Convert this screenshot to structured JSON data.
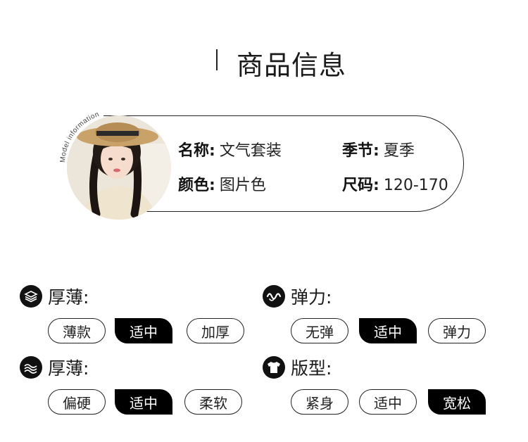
{
  "header": {
    "title": "商品信息"
  },
  "model": {
    "arc_text": "Model information"
  },
  "info": {
    "name_key": "名称",
    "name_value": "文气套装",
    "season_key": "季节",
    "season_value": "夏季",
    "color_key": "颜色",
    "color_value": "图片色",
    "size_key": "尺码",
    "size_value": "120-170",
    "colon": ":"
  },
  "attributes": [
    {
      "label": "厚薄:",
      "icon": "layers-icon",
      "options": [
        "薄款",
        "适中",
        "加厚"
      ],
      "selected": "适中"
    },
    {
      "label": "弹力:",
      "icon": "wave-icon",
      "options": [
        "无弹",
        "适中",
        "弹力"
      ],
      "selected": "适中"
    },
    {
      "label": "厚薄:",
      "icon": "fabric-icon",
      "options": [
        "偏硬",
        "适中",
        "柔软"
      ],
      "selected": "适中"
    },
    {
      "label": "版型:",
      "icon": "tshirt-icon",
      "options": [
        "紧身",
        "适中",
        "宽松"
      ],
      "selected": "宽松"
    }
  ],
  "colors": {
    "ink": "#1a1a1a",
    "selected_bg": "#000000",
    "page_bg": "#ffffff"
  }
}
